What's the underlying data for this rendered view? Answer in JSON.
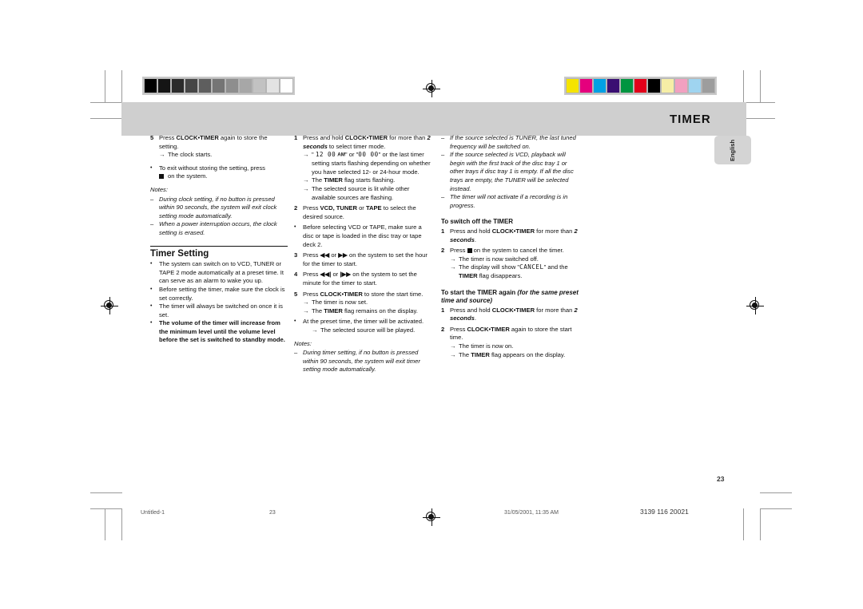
{
  "header": {
    "title": "TIMER",
    "language_tab": "English"
  },
  "calibration": {
    "grayscale_patches": [
      "#000000",
      "#151515",
      "#2b2b2b",
      "#464646",
      "#5e5e5e",
      "#757575",
      "#8e8e8e",
      "#a7a7a7",
      "#c2c2c2",
      "#e3e3e3",
      "#ffffff"
    ],
    "color_patches": [
      "#f5e400",
      "#e5007d",
      "#00a0e4",
      "#3a0f72",
      "#009540",
      "#e2001a",
      "#000000",
      "#f6eea6",
      "#f2a0c0",
      "#9fd4f0",
      "#9d9d9d"
    ]
  },
  "col1": {
    "step5": {
      "num": "5",
      "text_pre": "Press ",
      "bold": "CLOCK•TIMER",
      "text_post": " again to store the setting.",
      "arrow": "The clock starts."
    },
    "exit_bullet": {
      "marker": "•",
      "text_pre": "To exit without storing the setting, press",
      "text_post": " on the system."
    },
    "notes_label": "Notes:",
    "notes": [
      "During clock setting,  if no button is pressed within 90 seconds, the system will exit clock setting mode automatically.",
      "When a power interruption occurs, the clock setting is erased."
    ],
    "section_title": "Timer Setting",
    "bullets": [
      "The system can switch on to VCD, TUNER or TAPE 2 mode automatically at a preset time. It can serve as an alarm to wake you up.",
      "Before setting the timer, make sure the clock is set correctly.",
      "The timer will always be switched on once it is set."
    ],
    "bold_bullet": "The volume of the timer will increase from the minimum level until the volume level before the set is switched to standby mode."
  },
  "col2": {
    "step1": {
      "num": "1",
      "pre": "Press and hold ",
      "bold": "CLOCK•TIMER",
      "mid": " for more than ",
      "bolditalic": "2 seconds",
      "post": " to select timer mode.",
      "arrow1_a": "\" ",
      "arrow1_lcd1": "12 00",
      "arrow1_am": "AM",
      "arrow1_b": "\"  or  \"",
      "arrow1_lcd2": "00 00",
      "arrow1_c": "\" or the last timer setting starts flashing depending on whether you have selected 12- or 24-hour mode.",
      "arrow2_pre": "The ",
      "arrow2_bold": "TIMER",
      "arrow2_post": " flag starts flashing.",
      "arrow3": "The selected source is lit while other available sources are flashing."
    },
    "step2": {
      "num": "2",
      "pre": "Press ",
      "bold": "VCD, TUNER",
      "mid": " or ",
      "bold2": "TAPE",
      "post": " to select the desired source."
    },
    "bullet_before": "Before selecting VCD or TAPE, make sure a disc or tape is loaded in the disc tray or tape deck 2.",
    "step3": {
      "num": "3",
      "pre": "Press ",
      "btn1": "◀◀",
      "mid": " or ",
      "btn2": "▶▶",
      "post": " on the system to set the hour for the timer to start."
    },
    "step4": {
      "num": "4",
      "pre": "Press ",
      "btn1": "◀◀|",
      "mid": " or ",
      "btn2": "|▶▶",
      "post": " on the system to set the minute for the timer to start."
    },
    "step5": {
      "num": "5",
      "pre": "Press ",
      "bold": "CLOCK•TIMER",
      "post": " to store the start time.",
      "arrow1": "The timer is now set.",
      "arrow2_pre": "The ",
      "arrow2_bold": "TIMER",
      "arrow2_post": " flag remains on the display."
    },
    "bullet_preset": "At the preset time, the timer will be activated.",
    "bullet_preset_arrow": "The selected source will be played.",
    "notes_label": "Notes:",
    "notes": [
      "During timer setting, if no button is pressed within 90 seconds, the system will exit timer setting mode automatically."
    ]
  },
  "col3": {
    "notes": [
      "If the source selected is TUNER, the last tuned frequency will be switched on.",
      "If the source selected is VCD, playback will begin with the first track of the disc tray 1 or other trays if disc tray 1 is empty. If all the disc trays are empty, the TUNER will be selected instead.",
      "The timer will not activate if a recording is in progress."
    ],
    "switch_off_head_pre": "To switch off the ",
    "switch_off_head_bold": "TIMER",
    "off_step1": {
      "num": "1",
      "pre": "Press and hold ",
      "bold": "CLOCK•TIMER",
      "mid": " for more than ",
      "bolditalic": "2 seconds",
      "post": "."
    },
    "off_step2": {
      "num": "2",
      "pre": "Press ",
      "post": " on the system to cancel the timer.",
      "arrow1": "The timer is now switched off.",
      "arrow2_pre": "The display will show \"",
      "arrow2_lcd": "CANCEL",
      "arrow2_mid": "\" and the ",
      "arrow2_bold": "TIMER",
      "arrow2_post": " flag disappears."
    },
    "start_again_head_pre": "To start the ",
    "start_again_head_bold": "TIMER",
    "start_again_head_mid": " again ",
    "start_again_head_italic": "(for the same preset time and source)",
    "again_step1": {
      "num": "1",
      "pre": "Press and hold ",
      "bold": "CLOCK•TIMER",
      "mid": " for more than ",
      "bolditalic": "2 seconds",
      "post": "."
    },
    "again_step2": {
      "num": "2",
      "pre": "Press ",
      "bold": "CLOCK•TIMER",
      "post": " again to store the start time.",
      "arrow1": "The timer is now on.",
      "arrow2_pre": "The ",
      "arrow2_bold": "TIMER",
      "arrow2_post": " flag appears on the display."
    }
  },
  "footer": {
    "page_number": "23",
    "file_name": "Untitled-1",
    "file_page": "23",
    "timestamp": "31/05/2001, 11:35 AM",
    "doc_code": "3139 116 20021"
  }
}
